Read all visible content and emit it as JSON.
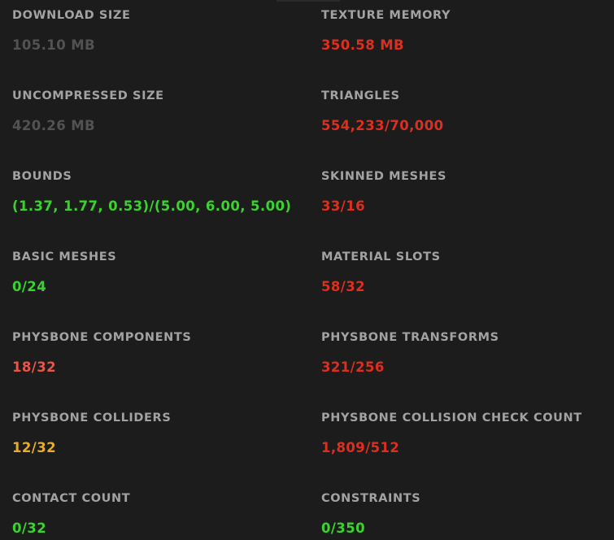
{
  "stats": [
    {
      "left": {
        "label": "DOWNLOAD SIZE",
        "value": "105.10 MB",
        "status": "gray"
      },
      "right": {
        "label": "TEXTURE MEMORY",
        "value": "350.58 MB",
        "status": "red"
      }
    },
    {
      "left": {
        "label": "UNCOMPRESSED SIZE",
        "value": "420.26 MB",
        "status": "gray"
      },
      "right": {
        "label": "TRIANGLES",
        "value": "554,233/70,000",
        "status": "red"
      }
    },
    {
      "left": {
        "label": "BOUNDS",
        "value": "(1.37, 1.77, 0.53)/(5.00, 6.00, 5.00)",
        "status": "green"
      },
      "right": {
        "label": "SKINNED MESHES",
        "value": "33/16",
        "status": "red"
      }
    },
    {
      "left": {
        "label": "BASIC MESHES",
        "value": "0/24",
        "status": "green"
      },
      "right": {
        "label": "MATERIAL SLOTS",
        "value": "58/32",
        "status": "red"
      }
    },
    {
      "left": {
        "label": "PHYSBONE COMPONENTS",
        "value": "18/32",
        "status": "salmon"
      },
      "right": {
        "label": "PHYSBONE TRANSFORMS",
        "value": "321/256",
        "status": "red"
      }
    },
    {
      "left": {
        "label": "PHYSBONE COLLIDERS",
        "value": "12/32",
        "status": "yellow"
      },
      "right": {
        "label": "PHYSBONE COLLISION CHECK COUNT",
        "value": "1,809/512",
        "status": "red"
      }
    },
    {
      "left": {
        "label": "CONTACT COUNT",
        "value": "0/32",
        "status": "green"
      },
      "right": {
        "label": "CONSTRAINTS",
        "value": "0/350",
        "status": "green"
      }
    }
  ],
  "colors": {
    "background": "#1c1c1c",
    "label": "#a2a2a2",
    "gray": "#525252",
    "red": "#dc2f20",
    "green": "#3ad32e",
    "salmon": "#e8564a",
    "yellow": "#e5ac2d"
  }
}
